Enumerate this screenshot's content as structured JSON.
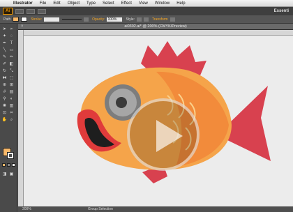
{
  "menubar": {
    "apple": "",
    "app_name": "Illustrator",
    "items": [
      "File",
      "Edit",
      "Object",
      "Type",
      "Select",
      "Effect",
      "View",
      "Window",
      "Help"
    ],
    "right_text": "Essenti"
  },
  "appbar": {
    "logo": "Ai"
  },
  "control": {
    "path_label": "Path",
    "stroke_label": "Stroke:",
    "opacity_label": "Opacity:",
    "opacity_value": "100%",
    "style_label": "Style:",
    "transform_label": "Transform",
    "fill_color": "#f8b86a"
  },
  "document": {
    "close": "×",
    "title": "ai0302.ai* @ 200% (CMYK/Preview)"
  },
  "status": {
    "zoom": "200%",
    "selection": "Group Selection"
  },
  "colors": {
    "fish_body": "#f5a44a",
    "fish_fin": "#d8414f",
    "lips": "#e03b3b",
    "eye": "#9b9b9b"
  }
}
